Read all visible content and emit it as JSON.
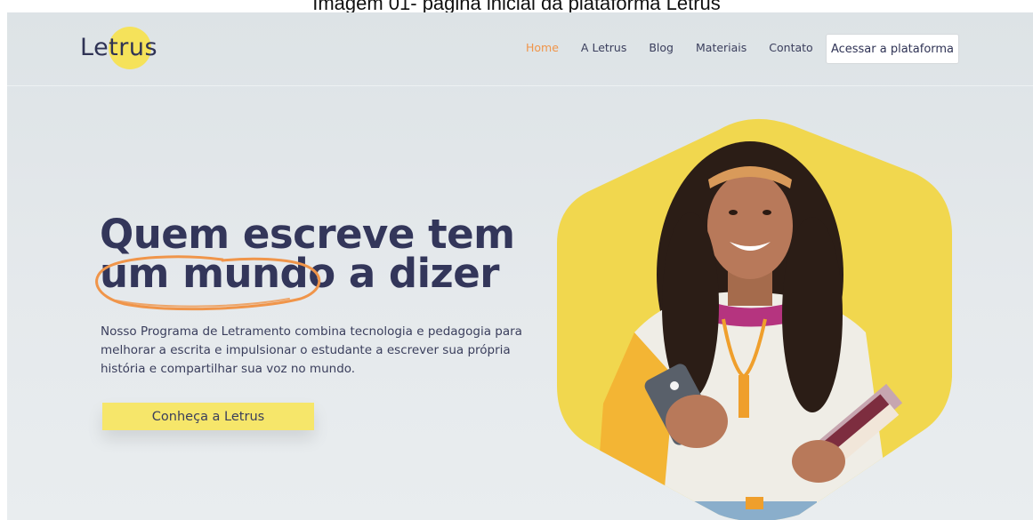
{
  "caption": "Imagem 01- página inicial da plataforma Letrus",
  "header": {
    "logo_text": "Letrus",
    "nav": [
      {
        "label": "Home",
        "active": true
      },
      {
        "label": "A Letrus",
        "active": false
      },
      {
        "label": "Blog",
        "active": false
      },
      {
        "label": "Materiais",
        "active": false
      },
      {
        "label": "Contato",
        "active": false
      }
    ],
    "cta_label": "Acessar a plataforma"
  },
  "hero": {
    "headline_line1": "Quem escreve tem",
    "headline_line2_highlight": "um mundo",
    "headline_line2_rest": " a dizer",
    "description": "Nosso Programa de Letramento combina tecnologia e pedagogia para melhorar a escrita e impulsionar o estudante a escrever sua própria história e compartilhar sua voz no mundo.",
    "cta_label": "Conheça a Letrus"
  },
  "colors": {
    "accent_orange": "#f0954a",
    "brand_yellow": "#f5e25a",
    "text_navy": "#33365a",
    "background": "#e2e7ea"
  },
  "icons": {
    "scribble": "hand-drawn-circle",
    "hero_photo": "student-with-phone-and-books"
  }
}
